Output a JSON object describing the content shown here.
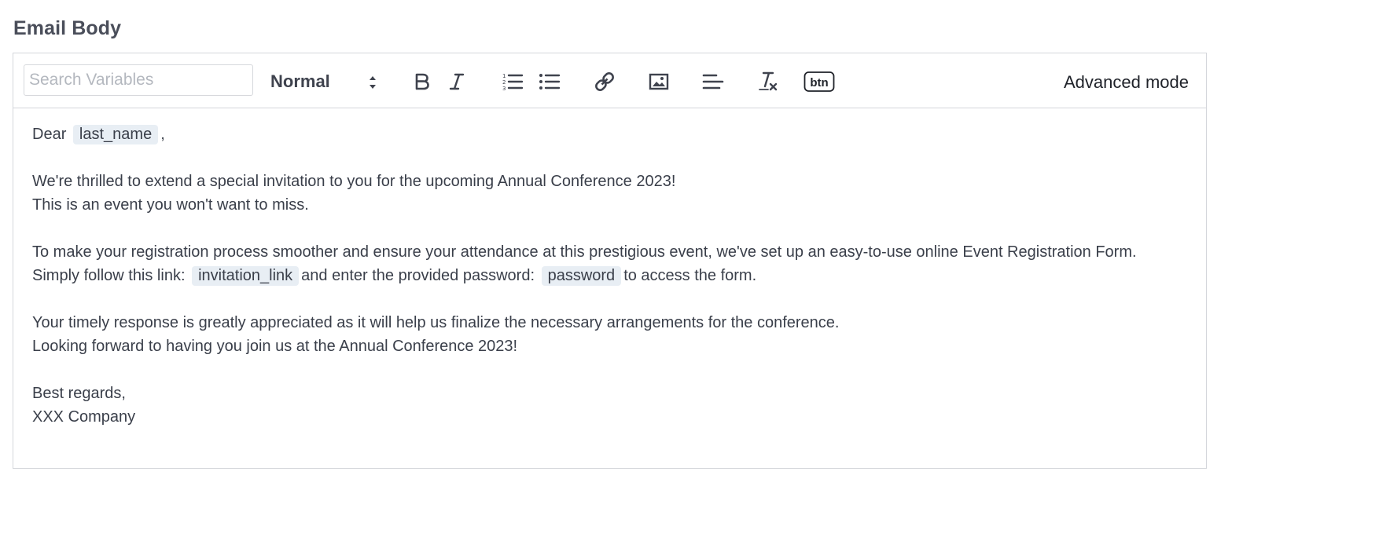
{
  "section_label": "Email Body",
  "toolbar": {
    "search_placeholder": "Search Variables",
    "format_select": "Normal",
    "buttons": {
      "bold": "bold-icon",
      "italic": "italic-icon",
      "ordered_list": "ordered-list-icon",
      "bullet_list": "bullet-list-icon",
      "link": "link-icon",
      "image": "image-icon",
      "align": "align-left-icon",
      "clear_format": "clear-format-icon",
      "button": "btn"
    },
    "advanced_mode": "Advanced mode"
  },
  "email": {
    "line1": {
      "prefix": "Dear",
      "var": "last_name",
      "suffix": ","
    },
    "line2": "We're thrilled to extend a special invitation to you for the upcoming Annual Conference 2023!",
    "line3": "This is an event you won't want to miss.",
    "line4": "To make your registration process smoother and ensure your attendance at this prestigious event, we've set up an easy-to-use online Event Registration Form.",
    "line5": {
      "part1": "Simply follow this link:",
      "var1": "invitation_link",
      "part2": "and enter the provided password:",
      "var2": "password",
      "part3": "to access the form."
    },
    "line6": "Your timely response is greatly appreciated as it will help us finalize the necessary arrangements for the conference.",
    "line7": "Looking forward to having you join us at the Annual Conference 2023!",
    "line8": "Best regards,",
    "line9": "XXX Company"
  },
  "colors": {
    "chip_bg": "#e8eef4",
    "border": "#d4d6db",
    "text": "#3a3f4a"
  }
}
